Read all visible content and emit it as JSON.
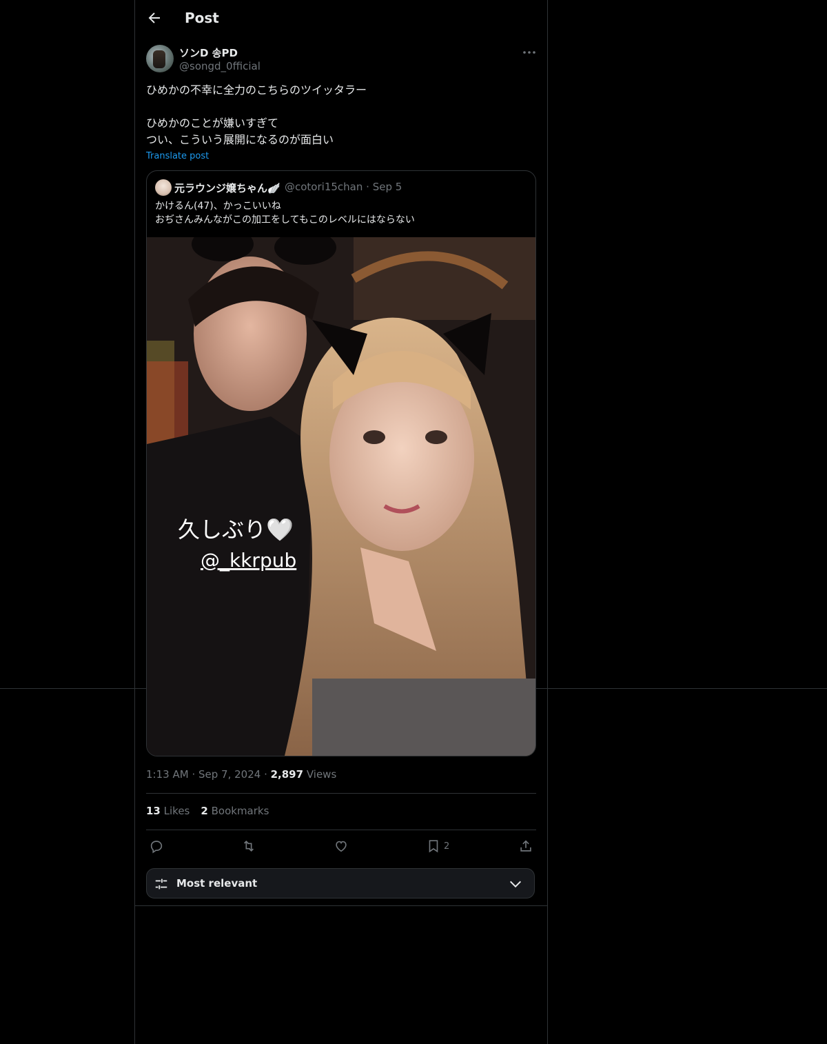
{
  "header": {
    "title": "Post"
  },
  "post": {
    "author_name": "ソンD 송PD",
    "author_handle": "@songd_0fficial",
    "text": "ひめかの不幸に全力のこちらのツイッタラー\n\nひめかのことが嫌いすぎて\nつい、こういう展開になるのが面白い",
    "translate_label": "Translate post",
    "quote": {
      "author_name": "元ラウンジ嬢ちゃん🪽",
      "author_handle": "@cotori15chan",
      "date": "Sep 5",
      "text": "かけるん(47)、かっこいいね\nおぢさんみんながこの加工をしてもこのレベルにはならない",
      "image_overlay_text": "久しぶり🤍",
      "image_overlay_handle": "@_kkrpub"
    },
    "time": "1:13 AM",
    "date": "Sep 7, 2024",
    "views_count": "2,897",
    "views_label": "Views",
    "likes_count": "13",
    "likes_label": "Likes",
    "bookmarks_count": "2",
    "bookmarks_label": "Bookmarks",
    "action_bookmark_count": "2"
  },
  "sort": {
    "label": "Most relevant"
  },
  "icons": [
    "back-arrow-icon",
    "more-icon",
    "reply-icon",
    "repost-icon",
    "like-icon",
    "bookmark-icon",
    "share-icon",
    "sliders-icon",
    "chevron-down-icon"
  ],
  "colors": {
    "background": "#000000",
    "text": "#e7e9ea",
    "muted": "#71767b",
    "link": "#1d9bf0",
    "border": "#2f3336"
  }
}
